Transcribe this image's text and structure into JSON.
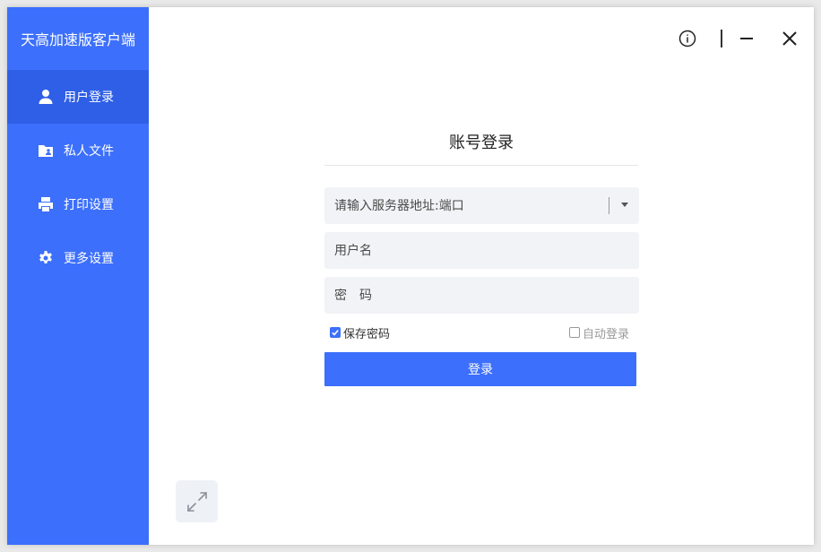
{
  "app": {
    "title": "天高加速版客户端"
  },
  "sidebar": {
    "items": [
      {
        "label": "用户登录",
        "icon": "user-icon",
        "active": true
      },
      {
        "label": "私人文件",
        "icon": "folder-user-icon",
        "active": false
      },
      {
        "label": "打印设置",
        "icon": "printer-icon",
        "active": false
      },
      {
        "label": "更多设置",
        "icon": "gear-icon",
        "active": false
      }
    ]
  },
  "window_controls": {
    "info_icon": "info-icon",
    "minimize_icon": "minimize-icon",
    "close_icon": "close-icon"
  },
  "login": {
    "title": "账号登录",
    "server_placeholder": "请输入服务器地址:端口",
    "username_placeholder": "用户名",
    "password_placeholder": "密　码",
    "save_password_label": "保存密码",
    "save_password_checked": true,
    "auto_login_label": "自动登录",
    "auto_login_checked": false,
    "submit_label": "登录"
  },
  "expand_icon": "expand-icon",
  "colors": {
    "accent": "#3c6ffb",
    "accent_active": "#2f5fe6",
    "field_bg": "#f1f3f6"
  }
}
